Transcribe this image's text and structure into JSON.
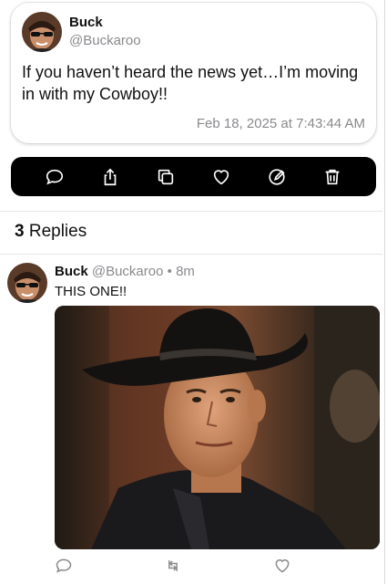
{
  "post": {
    "author_name": "Buck",
    "author_handle": "@Buckaroo",
    "text": "If you haven’t heard the news yet…I’m moving in with my Cowboy!!",
    "timestamp": "Feb 18, 2025 at 7:43:44 AM"
  },
  "action_bar": {
    "icons": [
      "reply-icon",
      "share-icon",
      "copy-icon",
      "like-icon",
      "edit-icon",
      "delete-icon"
    ]
  },
  "replies": {
    "count": "3",
    "label": "Replies",
    "items": [
      {
        "author_name": "Buck",
        "author_handle": "@Buckaroo",
        "separator": "•",
        "age": "8m",
        "text": "THIS ONE!!"
      }
    ]
  },
  "colors": {
    "action_bar_bg": "#000000",
    "secondary_text": "#8a8a8e",
    "divider": "#e6e6e6"
  }
}
